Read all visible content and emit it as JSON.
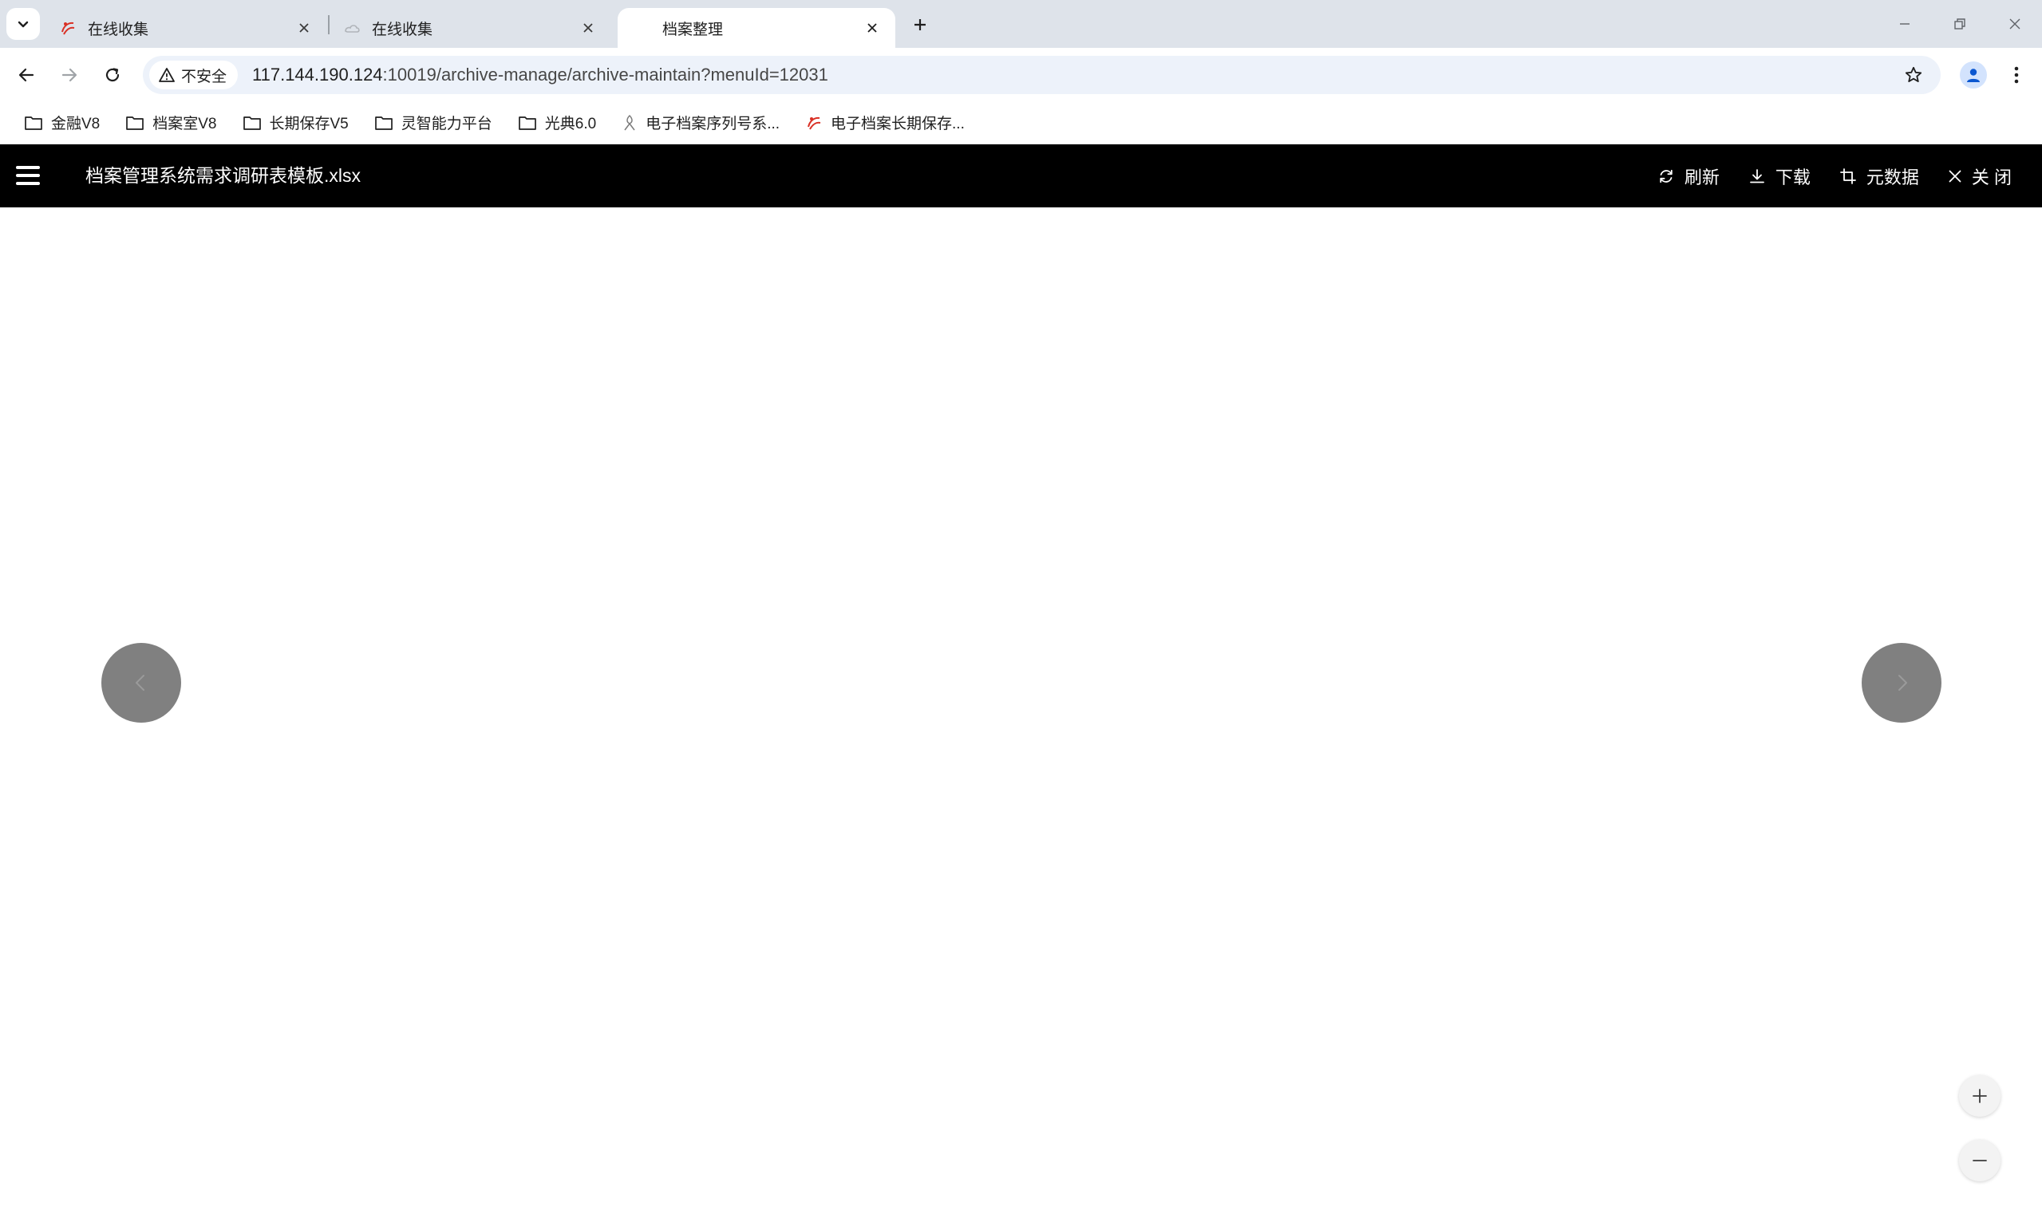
{
  "browser": {
    "tabs": [
      {
        "title": "在线收集",
        "favicon": "red-swirl-logo",
        "active": false
      },
      {
        "title": "在线收集",
        "favicon": "grey-cloud-logo",
        "active": false
      },
      {
        "title": "档案整理",
        "favicon": "none",
        "active": true
      }
    ],
    "address": {
      "security_label": "不安全",
      "url_host": "117.144.190.124",
      "url_rest": ":10019/archive-manage/archive-maintain?menuId=12031"
    },
    "bookmarks": [
      {
        "label": "金融V8",
        "icon": "folder-icon"
      },
      {
        "label": "档案室V8",
        "icon": "folder-icon"
      },
      {
        "label": "长期保存V5",
        "icon": "folder-icon"
      },
      {
        "label": "灵智能力平台",
        "icon": "folder-icon"
      },
      {
        "label": "光典6.0",
        "icon": "folder-icon"
      },
      {
        "label": "电子档案序列号系...",
        "icon": "grey-logo-icon"
      },
      {
        "label": "电子档案长期保存...",
        "icon": "red-swirl-logo"
      }
    ]
  },
  "app": {
    "document_title": "档案管理系统需求调研表模板.xlsx",
    "actions": {
      "refresh": "刷新",
      "download": "下载",
      "metadata": "元数据",
      "close": "关 闭"
    }
  },
  "colors": {
    "tabstrip_bg": "#dee3ea",
    "omnibox_bg": "#edf2fa",
    "header_bg": "#000000",
    "nav_circle": "#808080"
  }
}
